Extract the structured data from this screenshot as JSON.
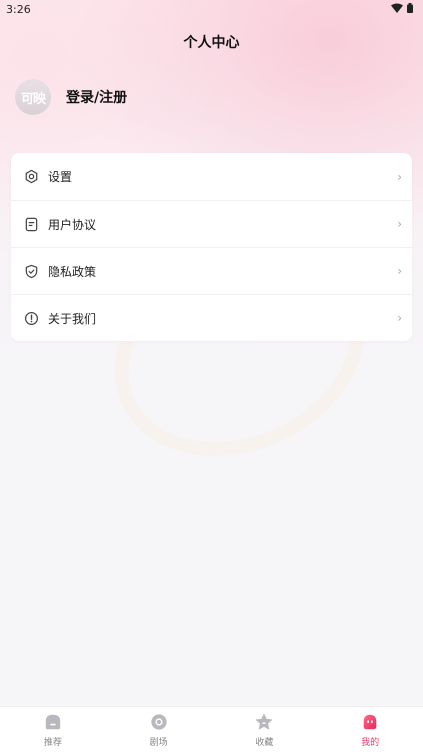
{
  "status_bar": {
    "time": "3:26",
    "icons": [
      "wifi-icon",
      "battery-icon"
    ]
  },
  "header": {
    "title": "个人中心"
  },
  "profile": {
    "avatar_text": "可映",
    "login_label": "登录/注册"
  },
  "menu": {
    "items": [
      {
        "label": "设置",
        "icon": "gear-icon"
      },
      {
        "label": "用户协议",
        "icon": "document-icon"
      },
      {
        "label": "隐私政策",
        "icon": "shield-check-icon"
      },
      {
        "label": "关于我们",
        "icon": "info-icon"
      }
    ]
  },
  "tab_bar": {
    "tabs": [
      {
        "label": "推荐",
        "icon": "home-icon",
        "active": false
      },
      {
        "label": "剧场",
        "icon": "theater-icon",
        "active": false
      },
      {
        "label": "收藏",
        "icon": "star-icon",
        "active": false
      },
      {
        "label": "我的",
        "icon": "profile-icon",
        "active": true
      }
    ]
  },
  "colors": {
    "accent": "#ef3a6a",
    "inactive_icon": "#b8b8be",
    "page_bg": "#f6f6f9"
  }
}
